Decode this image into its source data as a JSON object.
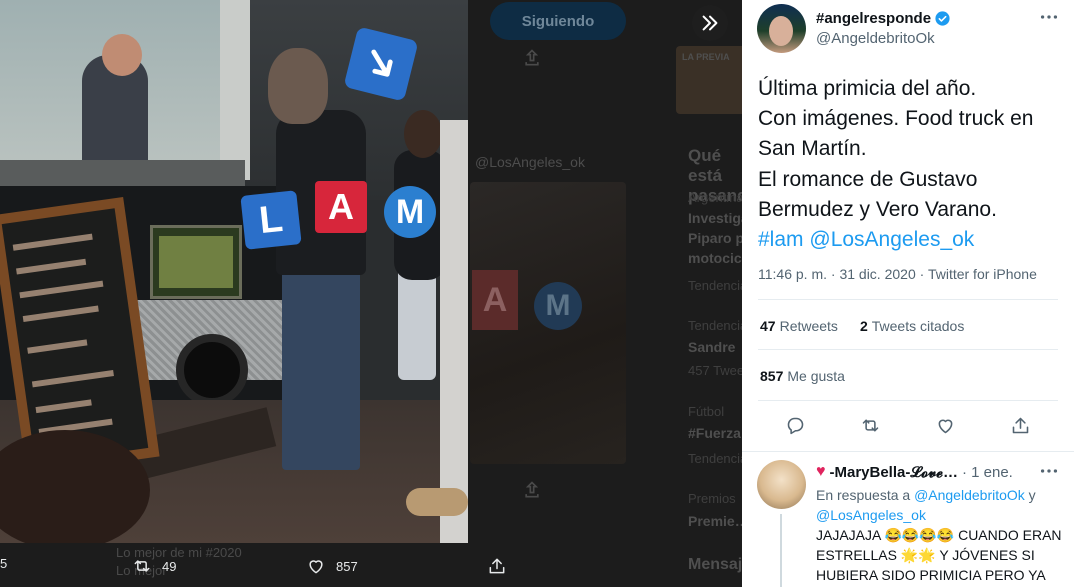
{
  "background": {
    "follow_button": "Siguiendo",
    "thumb_label": "LA PREVIA",
    "handle": "@LosAngeles_ok",
    "trends_title": "Qué está pasando",
    "trends": [
      {
        "category": "Argentina",
        "title": "Investiga…",
        "line2": "Piparo p…",
        "line3": "motocic…"
      },
      {
        "category": "Tendencia",
        "title": "",
        "line2": "",
        "line3": ""
      },
      {
        "category": "Tendencia",
        "title": "Sandre",
        "line2": "457 Tweets",
        "line3": ""
      },
      {
        "category": "Fútbol",
        "title": "#Fuerza…",
        "line2": "Tendencia",
        "line3": ""
      },
      {
        "category": "Premios",
        "title": "Premie…",
        "line2": "",
        "line3": ""
      }
    ],
    "messages": "Mensajes",
    "bottom_left_text": "Lo mejor de mi #2020",
    "bottom_left_text2": "Lo mejor"
  },
  "media_bar": {
    "reply_count": "5",
    "retweet_count": "49",
    "like_count": "857"
  },
  "photo": {
    "logo_letters": [
      "L",
      "A",
      "M"
    ]
  },
  "tweet": {
    "author_name": "#angelresponde",
    "author_handle": "@AngeldebritoOk",
    "lines": [
      "Última primicia del año.",
      "Con imágenes. Food truck en",
      "San Martín.",
      "El romance de Gustavo",
      "Bermudez y Vero Varano."
    ],
    "hashtag": "#lam",
    "mention": "@LosAngeles_ok",
    "time": "11:46 p. m. · 31 dic. 2020",
    "source": "Twitter for iPhone",
    "retweets_count": "47",
    "retweets_label": "Retweets",
    "quotes_count": "2",
    "quotes_label": "Tweets citados",
    "likes_count": "857",
    "likes_label": "Me gusta"
  },
  "reply": {
    "name": "-MaryBella-𝓛𝓸𝓿𝓮…",
    "date": "· 1 ene.",
    "replying_prefix": "En respuesta a",
    "replying_to_1": "@AngeldebritoOk",
    "replying_and": "y",
    "replying_to_2": "@LosAngeles_ok",
    "text": "JAJAJAJA 😂😂😂😂 CUANDO ERAN ESTRELLAS 🌟🌟 Y JÓVENES SI HUBIERA SIDO PRIMICIA PERO YA"
  },
  "colors": {
    "accent": "#1d9bf0",
    "lam_red": "#d7263b",
    "lam_blue": "#2b6fc9"
  }
}
